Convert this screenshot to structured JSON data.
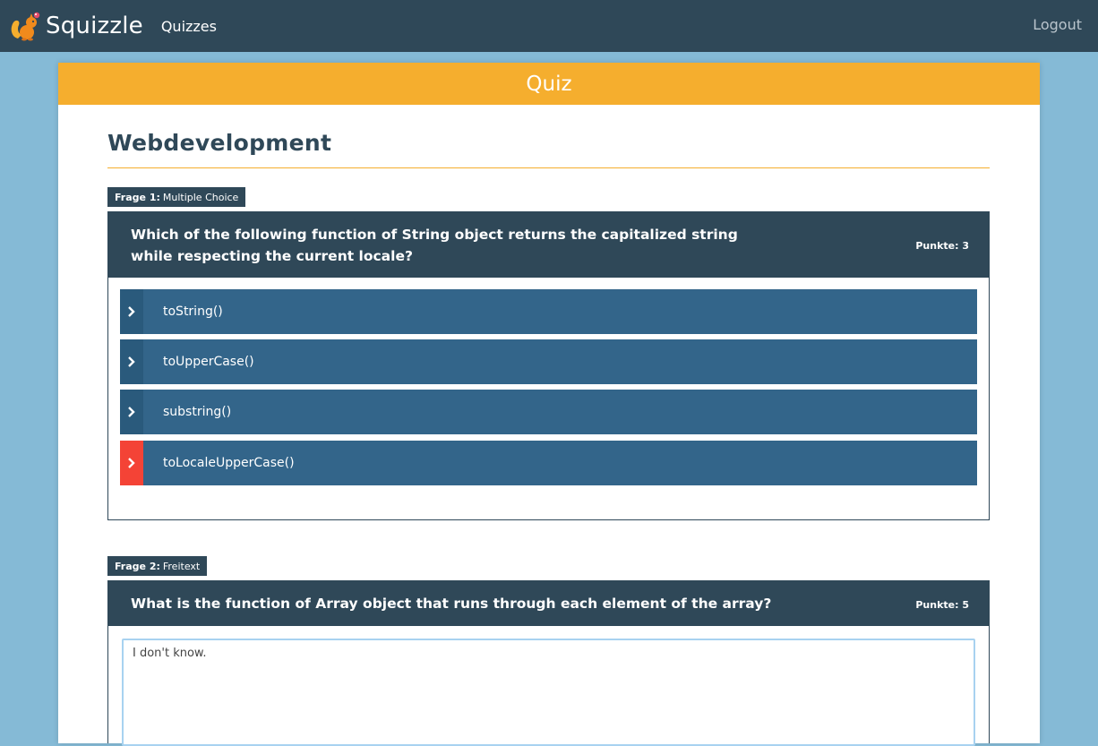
{
  "navbar": {
    "brand": "Squizzle",
    "links": [
      "Quizzes"
    ],
    "logout": "Logout"
  },
  "card": {
    "header": "Quiz"
  },
  "quiz": {
    "title": "Webdevelopment",
    "questions": [
      {
        "tag_number": "Frage 1:",
        "tag_type": "Multiple Choice",
        "text": "Which of the following function of String object returns the capitalized string while respecting the current locale?",
        "points": "Punkte: 3",
        "answers": [
          "toString()",
          "toUpperCase()",
          "substring()",
          "toLocaleUpperCase()"
        ],
        "selected_index": 3
      },
      {
        "tag_number": "Frage 2:",
        "tag_type": "Freitext",
        "text": "What is the function of Array object that runs through each element of the array?",
        "points": "Punkte: 5",
        "answer_value": "I don't know."
      }
    ]
  },
  "colors": {
    "navbar": "#2f4858",
    "page_bg": "#85bad6",
    "header": "#f5ae2e",
    "answer": "#33658a",
    "selected": "#f44336"
  }
}
